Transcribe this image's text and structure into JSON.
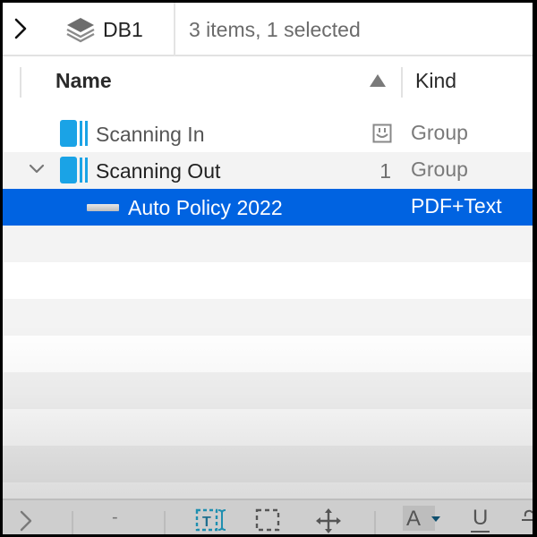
{
  "topbar": {
    "expand_icon": "chevron-right-icon",
    "database_icon": "layers-icon",
    "database_name": "DB1",
    "status": "3 items, 1 selected"
  },
  "columns": {
    "name": "Name",
    "sort_icon": "sort-ascending-icon",
    "kind": "Kind"
  },
  "rows": [
    {
      "name": "Scanning In",
      "icon": "group-folder-icon",
      "badge_icon": "smart-group-icon",
      "count": "",
      "kind": "Group",
      "expanded": false,
      "selected": false
    },
    {
      "name": "Scanning Out",
      "icon": "group-folder-icon",
      "count": "1",
      "kind": "Group",
      "expanded": true,
      "selected": false
    },
    {
      "name": "Auto Policy 2022",
      "icon": "pdf-document-icon",
      "count": "",
      "kind": "PDF+Text",
      "expanded": false,
      "selected": true
    }
  ],
  "toolbar": {
    "items": [
      "chevron-right-icon",
      "minus",
      "text-selection-icon",
      "rectangle-selection-icon",
      "move-icon",
      "font-color-icon",
      "underline-icon",
      "strikethrough-icon"
    ],
    "minus_label": "-",
    "font_label": "A",
    "underline_label": "U"
  },
  "colors": {
    "selection": "#0063e1",
    "group_icon": "#1aa3e6",
    "text_tool": "#1f8fb0"
  }
}
